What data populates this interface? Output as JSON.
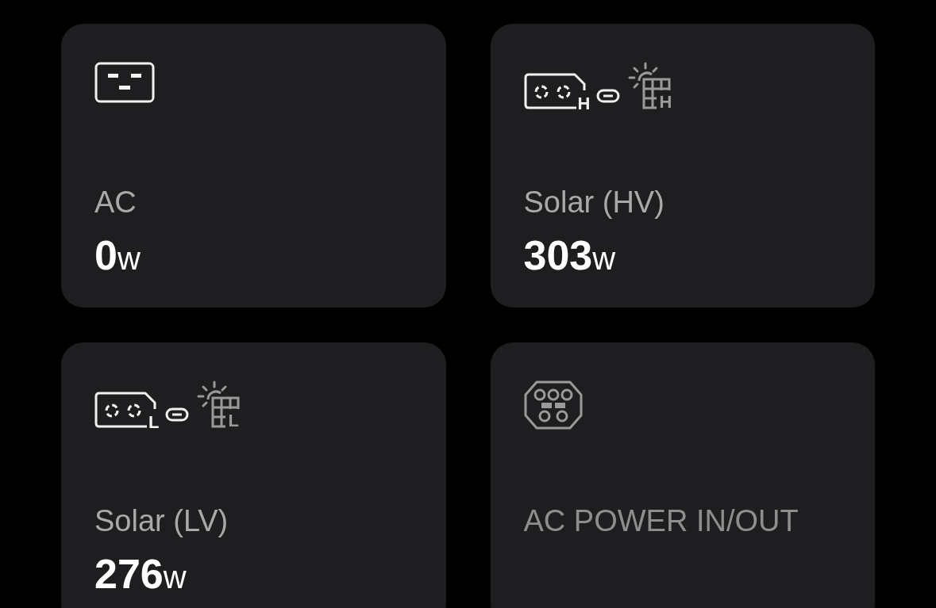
{
  "cards": [
    {
      "icon": {
        "kind": "outlet"
      },
      "label": "AC",
      "value": "0",
      "unit": "w"
    },
    {
      "icon": {
        "kind": "solar",
        "tag": "H",
        "panel_tag": "H"
      },
      "label": "Solar (HV)",
      "value": "303",
      "unit": "w"
    },
    {
      "icon": {
        "kind": "solar",
        "tag": "L",
        "panel_tag": "L"
      },
      "label": "Solar (LV)",
      "value": "276",
      "unit": "w"
    },
    {
      "icon": {
        "kind": "plug"
      },
      "label": "AC POWER IN/OUT"
    }
  ]
}
